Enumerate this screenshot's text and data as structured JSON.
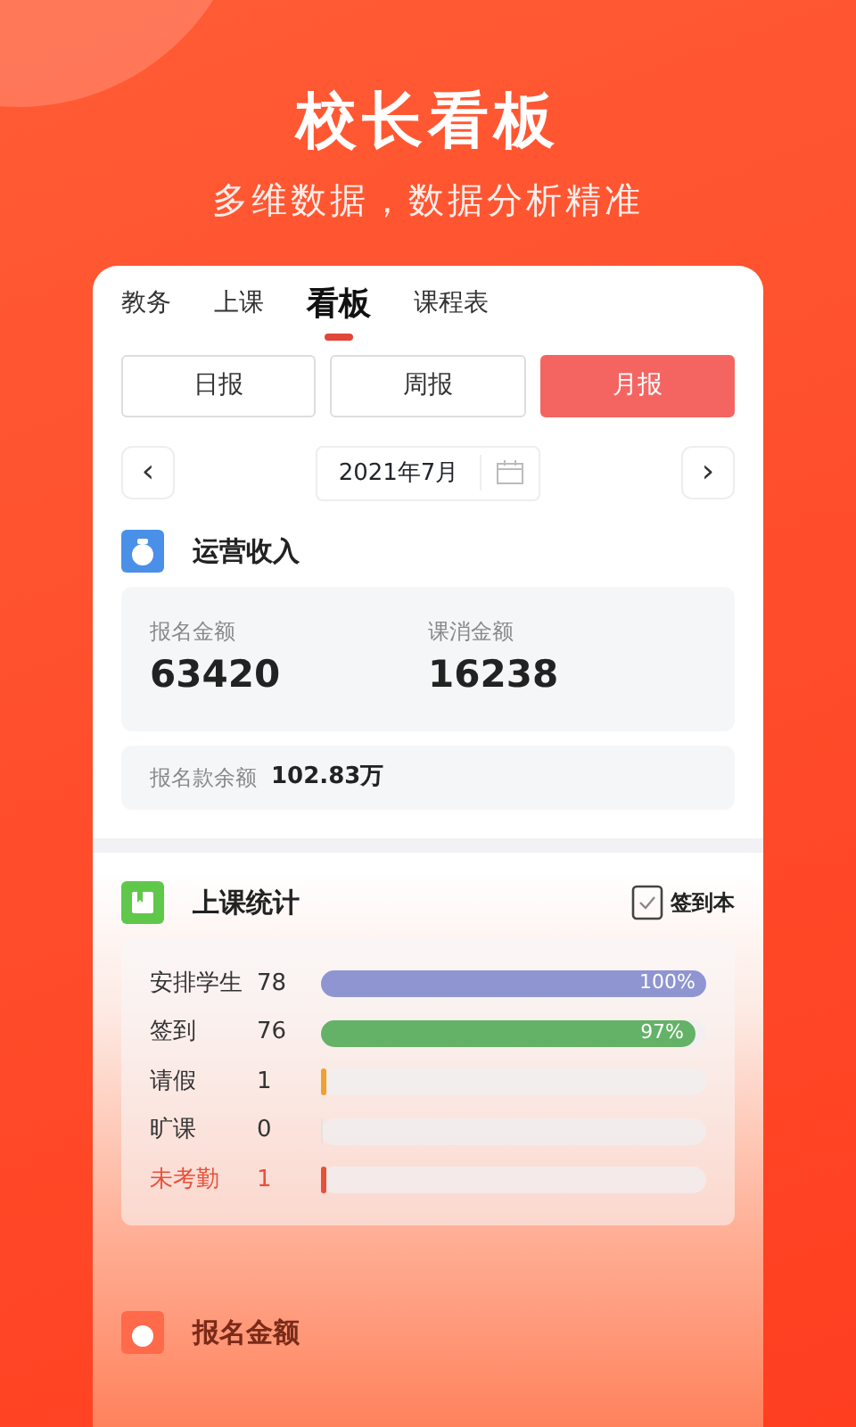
{
  "header": {
    "title": "校长看板",
    "subtitle": "多维数据，数据分析精准"
  },
  "tabs": [
    {
      "label": "教务",
      "selected": false
    },
    {
      "label": "上课",
      "selected": false
    },
    {
      "label": "看板",
      "selected": true
    },
    {
      "label": "课程表",
      "selected": false
    }
  ],
  "periods": [
    {
      "label": "日报",
      "selected": false
    },
    {
      "label": "周报",
      "selected": false
    },
    {
      "label": "月报",
      "selected": true
    }
  ],
  "date_picker": {
    "prev": "‹",
    "value": "2021年7月",
    "next": "›"
  },
  "revenue": {
    "title": "运营收入",
    "metrics": [
      {
        "label": "报名金额",
        "value": "63420"
      },
      {
        "label": "课消金额",
        "value": "16238"
      }
    ],
    "balance": {
      "label": "报名款余额",
      "value": "102.83万"
    }
  },
  "attendance": {
    "title": "上课统计",
    "action": "签到本",
    "rows": [
      {
        "label": "安排学生",
        "count": "78",
        "level": 1.0,
        "percent": "100%",
        "color": "#8e95d0",
        "kind": "normal"
      },
      {
        "label": "签到",
        "count": "76",
        "level": 0.97,
        "percent": "97%",
        "color": "#63b267",
        "kind": "normal"
      },
      {
        "label": "请假",
        "count": "1",
        "level": 0.013,
        "color": "#f0a030",
        "kind": "normal"
      },
      {
        "label": "旷课",
        "count": "0",
        "level": 0,
        "kind": "normal"
      },
      {
        "label": "未考勤",
        "count": "1",
        "level": 0.013,
        "color": "#e8503a",
        "kind": "alert"
      }
    ]
  },
  "next_section": {
    "title": "报名金额"
  }
}
